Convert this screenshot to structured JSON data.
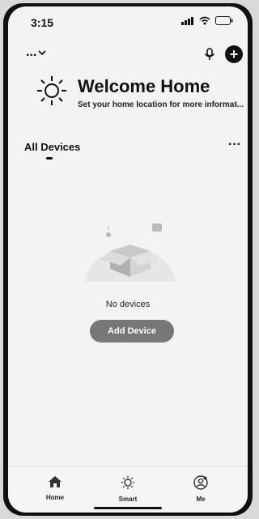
{
  "status": {
    "time": "3:15"
  },
  "topbar": {
    "home_switcher": "...",
    "chevron": "⌄",
    "add_symbol": "+"
  },
  "welcome": {
    "title": "Welcome Home",
    "subtitle": "Set your home location for more informat...",
    "arrow": "›"
  },
  "devices": {
    "title": "All Devices",
    "more": "···",
    "empty_text": "No devices",
    "add_button": "Add Device"
  },
  "tabs": [
    {
      "label": "Home",
      "icon": "home-icon"
    },
    {
      "label": "Smart",
      "icon": "sun-icon"
    },
    {
      "label": "Me",
      "icon": "user-icon"
    }
  ],
  "colors": {
    "accent": "#777777",
    "text": "#111111",
    "background": "#f3f3f3"
  }
}
